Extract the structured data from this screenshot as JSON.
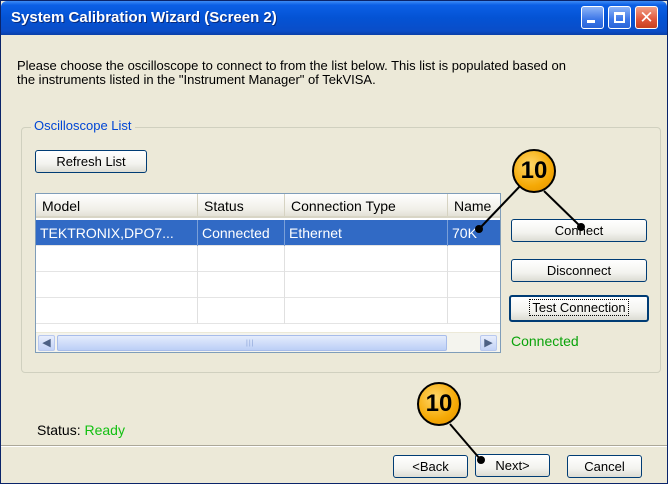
{
  "window": {
    "title": "System Calibration Wizard (Screen 2)",
    "controls": {
      "minimize": "minimize-icon",
      "maximize": "maximize-icon",
      "close": "close-icon"
    }
  },
  "intro_text": "Please choose the oscilloscope to connect to from the list below. This list is populated based on the instruments listed in the \"Instrument Manager\" of TekVISA.",
  "group": {
    "label": "Oscilloscope List",
    "refresh_label": "Refresh List"
  },
  "table": {
    "columns": [
      "Model",
      "Status",
      "Connection Type",
      "Name"
    ],
    "rows": [
      {
        "model": "TEKTRONIX,DPO7...",
        "status": "Connected",
        "connection_type": "Ethernet",
        "name": "70K"
      }
    ]
  },
  "buttons": {
    "connect": "Connect",
    "disconnect": "Disconnect",
    "test_connection": "Test Connection",
    "back": "<Back",
    "next": "Next>",
    "cancel": "Cancel"
  },
  "connection_status": "Connected",
  "status": {
    "label": "Status:",
    "value": "Ready"
  },
  "callouts": {
    "top": "10",
    "bottom": "10"
  },
  "colors": {
    "titlebar": "#0453d4",
    "selection": "#316ac5",
    "connected_text": "#0aa30a",
    "callout": "#f5a905"
  }
}
